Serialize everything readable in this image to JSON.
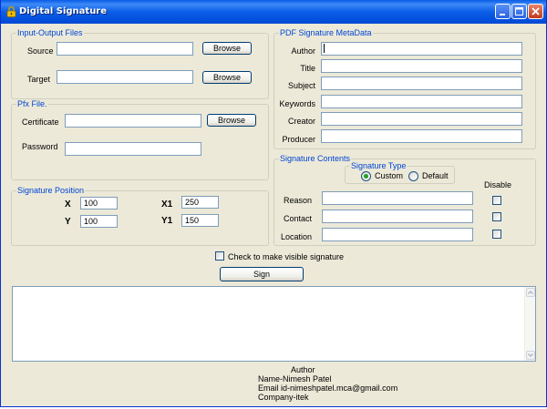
{
  "window": {
    "title": "Digital Signature"
  },
  "io_group": {
    "legend": "Input-Output Files",
    "source_label": "Source",
    "source_value": "",
    "target_label": "Target",
    "target_value": "",
    "browse_label": "Browse"
  },
  "pfx_group": {
    "legend": "Pfx File.",
    "certificate_label": "Certificate",
    "certificate_value": "",
    "password_label": "Password",
    "password_value": "",
    "browse_label": "Browse"
  },
  "position_group": {
    "legend": "Signature Position",
    "x_label": "X",
    "x_value": "100",
    "y_label": "Y",
    "y_value": "100",
    "x1_label": "X1",
    "x1_value": "250",
    "y1_label": "Y1",
    "y1_value": "150"
  },
  "metadata_group": {
    "legend": "PDF Signature  MetaData",
    "fields": [
      {
        "label": "Author",
        "value": ""
      },
      {
        "label": "Title",
        "value": ""
      },
      {
        "label": "Subject",
        "value": ""
      },
      {
        "label": "Keywords",
        "value": ""
      },
      {
        "label": "Creator",
        "value": ""
      },
      {
        "label": "Producer",
        "value": ""
      }
    ]
  },
  "contents_group": {
    "legend": "Signature Contents",
    "type_legend": "Signature Type",
    "custom_label": "Custom",
    "default_label": "Default",
    "selected_type": "Custom",
    "disable_label": "Disable",
    "fields": [
      {
        "label": "Reason",
        "value": "",
        "disabled": false
      },
      {
        "label": "Contact",
        "value": "",
        "disabled": false
      },
      {
        "label": "Location",
        "value": "",
        "disabled": false
      }
    ]
  },
  "visible_checkbox": {
    "label": "Check to make visible signature",
    "checked": false
  },
  "sign_button": {
    "label": "Sign"
  },
  "log_output": "",
  "footer": {
    "line1": "Author",
    "line2": "Name-Nimesh Patel",
    "line3": "Email id-nimeshpatel.mca@gmail.com",
    "line4": "Company-itek"
  },
  "colors": {
    "titlebar": "#0a5ce6",
    "window_bg": "#ece9d8",
    "legend_text": "#0046d5",
    "radio_selected": "#21a121",
    "close_button": "#c0391b"
  },
  "icons": {
    "app": "lock-icon",
    "minimize": "minimize-icon",
    "maximize": "maximize-icon",
    "close": "close-icon"
  }
}
